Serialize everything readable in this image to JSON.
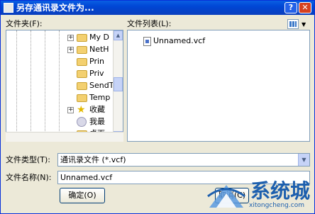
{
  "window": {
    "title": "另存通讯录文件为...",
    "help_glyph": "?",
    "close_glyph": "✕"
  },
  "folder_pane": {
    "label": "文件夹(F):",
    "items": [
      {
        "label": "My D",
        "expander": "+"
      },
      {
        "label": "NetH",
        "expander": "+"
      },
      {
        "label": "Prin",
        "expander": ""
      },
      {
        "label": "Priv",
        "expander": ""
      },
      {
        "label": "SendT",
        "expander": ""
      },
      {
        "label": "Temp",
        "expander": ""
      },
      {
        "label": "收藏",
        "expander": "+"
      },
      {
        "label": "我最",
        "expander": ""
      },
      {
        "label": "桌面",
        "expander": ""
      }
    ]
  },
  "file_pane": {
    "label": "文件列表(L):",
    "files": [
      "Unnamed.vcf"
    ]
  },
  "file_type": {
    "label": "文件类型(T):",
    "value": "通讯录文件 (*.vcf)"
  },
  "file_name": {
    "label": "文件名称(N):",
    "value": "Unnamed.vcf"
  },
  "buttons": {
    "ok": "确定(O)",
    "cancel": "取消(C)"
  },
  "watermark": {
    "brand": "系统城",
    "url": "xitongcheng.com"
  },
  "colors": {
    "titlebar": "#0046d5",
    "dialog_bg": "#ece9d8",
    "watermark": "#1d5fae"
  }
}
